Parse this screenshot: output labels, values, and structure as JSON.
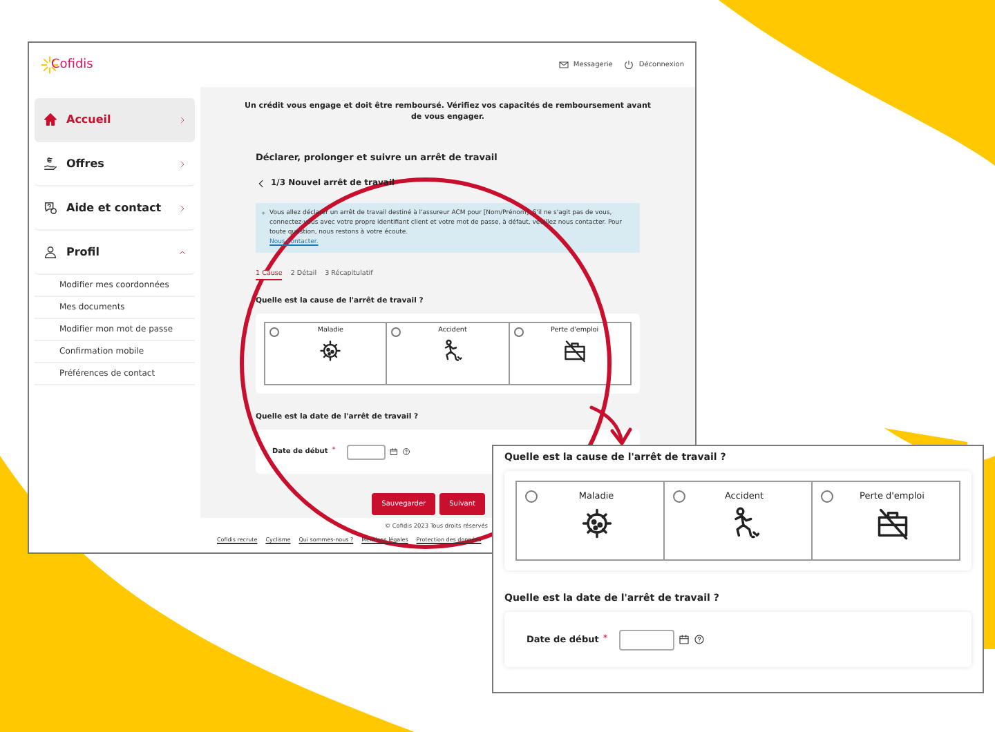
{
  "window": {
    "logo": "Cofidis",
    "links": [
      {
        "kind": "mail",
        "label": "Messagerie"
      },
      {
        "kind": "power",
        "label": "Déconnexion"
      }
    ]
  },
  "sidebar": {
    "items": [
      {
        "kind": "home",
        "label": "Accueil",
        "selected": true,
        "expanded": false
      },
      {
        "kind": "offers",
        "label": "Offres",
        "selected": false,
        "expanded": false
      },
      {
        "kind": "help",
        "label": "Aide et contact",
        "selected": false,
        "expanded": false
      },
      {
        "kind": "profile",
        "label": "Profil",
        "selected": false,
        "expanded": true,
        "children": [
          {
            "label": "Modifier mes coordonnées"
          },
          {
            "label": "Mes documents"
          },
          {
            "label": "Modifier mon mot de passe"
          },
          {
            "label": "Confirmation mobile"
          },
          {
            "label": "Préférences de contact"
          }
        ]
      }
    ]
  },
  "content": {
    "notice": "Un crédit vous engage et doit être remboursé. Vérifiez vos capacités de remboursement avant de vous engager.",
    "heading": "Déclarer, prolonger et suivre un arrêt de travail",
    "back_title": "1/3 Nouvel arrêt de travail",
    "info": {
      "text": "Vous allez déclarer un arrêt de travail destiné à l'assureur ACM pour [Nom/Prénom]. S'il ne s'agit pas de vous, connectez-vous avec votre propre identifiant client et votre mot de passe, à défaut, veuillez nous contacter. Pour toute question, nous restons à votre écoute.",
      "link": "Nous contacter."
    },
    "steps": [
      {
        "label": "1 Cause",
        "selected": true
      },
      {
        "label": "2 Détail",
        "selected": false
      },
      {
        "label": "3 Récapitulatif",
        "selected": false
      }
    ],
    "cause_question": "Quelle est la cause de l'arrêt de travail ?",
    "causes": [
      {
        "kind": "illness",
        "label": "Maladie",
        "selected": false
      },
      {
        "kind": "accident",
        "label": "Accident",
        "selected": false
      },
      {
        "kind": "job_loss",
        "label": "Perte d'emploi",
        "selected": false
      }
    ],
    "date_question": "Quelle est la date de l'arrêt de travail ?",
    "date_field": {
      "label": "Date de début",
      "required": true,
      "required_mark": "*"
    },
    "buttons": [
      "Sauvegarder",
      "Suivant"
    ]
  },
  "footer": {
    "copyright": "© Cofidis 2023 Tous droits réservés",
    "links": [
      "Cofidis recrute",
      "Cyclisme",
      "Qui sommes-nous ?",
      "Mentions légales",
      "Protection des données"
    ]
  },
  "zoom_inset": {
    "cause_question": "Quelle est la cause de l'arrêt de travail ?",
    "causes": [
      {
        "kind": "illness",
        "label": "Maladie",
        "selected": false
      },
      {
        "kind": "accident",
        "label": "Accident",
        "selected": false
      },
      {
        "kind": "job_loss",
        "label": "Perte d'emploi",
        "selected": false
      }
    ],
    "date_question": "Quelle est la date de l'arrêt de travail ?",
    "date_field": {
      "label": "Date de début",
      "required": true,
      "required_mark": "*"
    }
  }
}
